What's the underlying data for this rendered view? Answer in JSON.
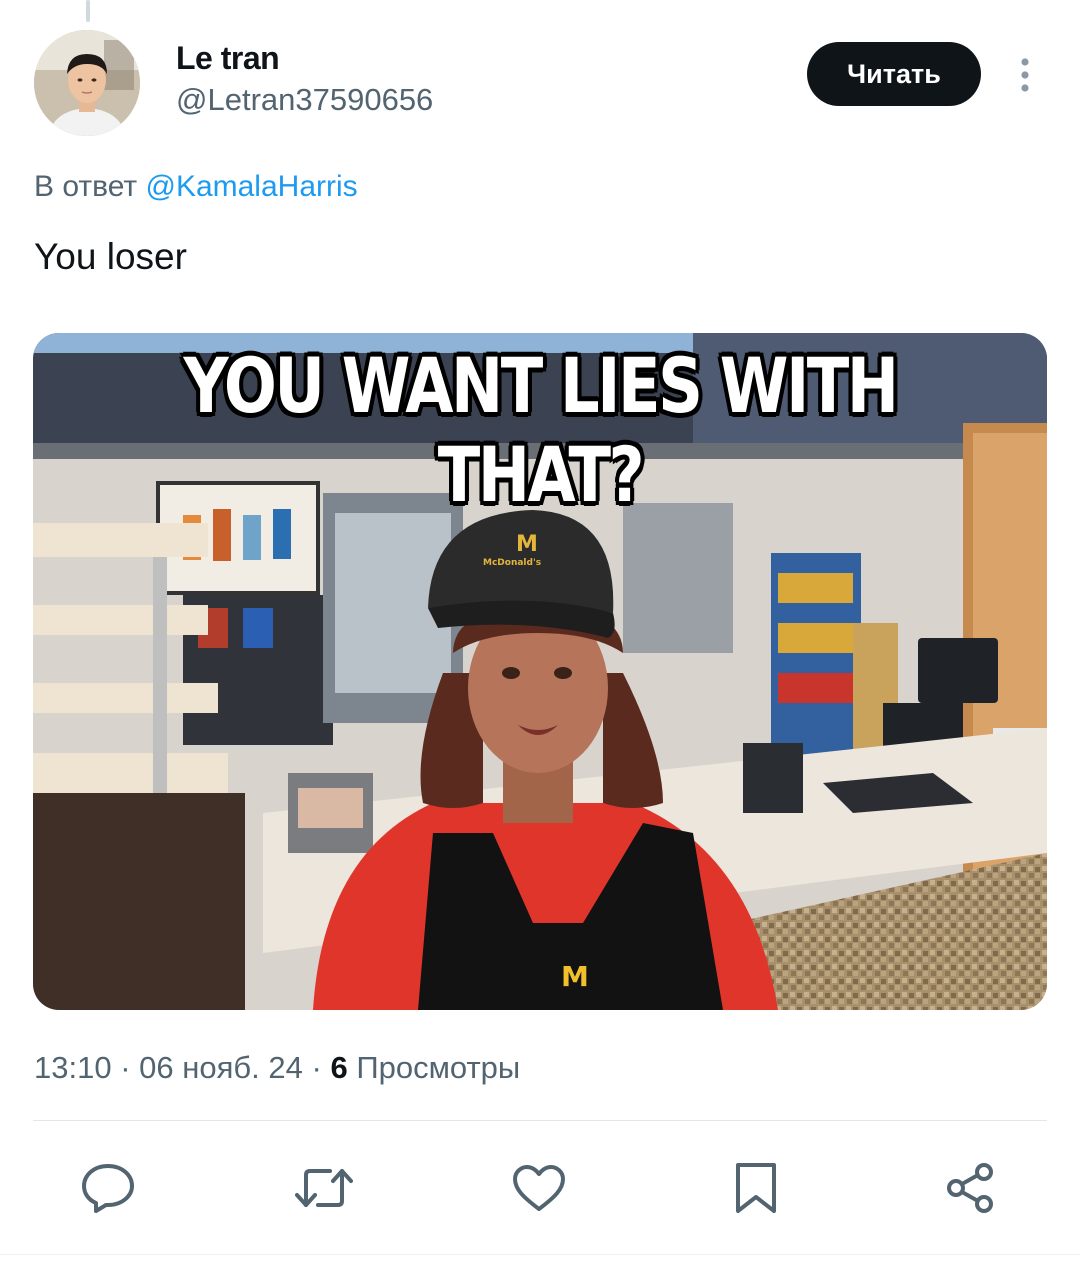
{
  "author": {
    "display_name": "Le tran",
    "handle": "@Letran37590656"
  },
  "follow_button": {
    "label": "Читать"
  },
  "reply_context": {
    "prefix": "В ответ",
    "mention": "@KamalaHarris"
  },
  "tweet": {
    "text": "You loser",
    "media": {
      "caption": "YOU WANT LIES WITH THAT?",
      "logo_letter": "M",
      "cap_text": "McDonald's"
    }
  },
  "meta": {
    "time": "13:10",
    "separator": "·",
    "date": "06 нояб. 24",
    "views_count": "6",
    "views_label": "Просмотры"
  },
  "actions": [
    {
      "icon": "reply-icon"
    },
    {
      "icon": "retweet-icon"
    },
    {
      "icon": "like-icon"
    },
    {
      "icon": "bookmark-icon"
    },
    {
      "icon": "share-icon"
    }
  ],
  "colors": {
    "link": "#1d9bf0",
    "secondary_text": "#536471",
    "primary_text": "#0f1419",
    "button_bg": "#0f1419"
  }
}
